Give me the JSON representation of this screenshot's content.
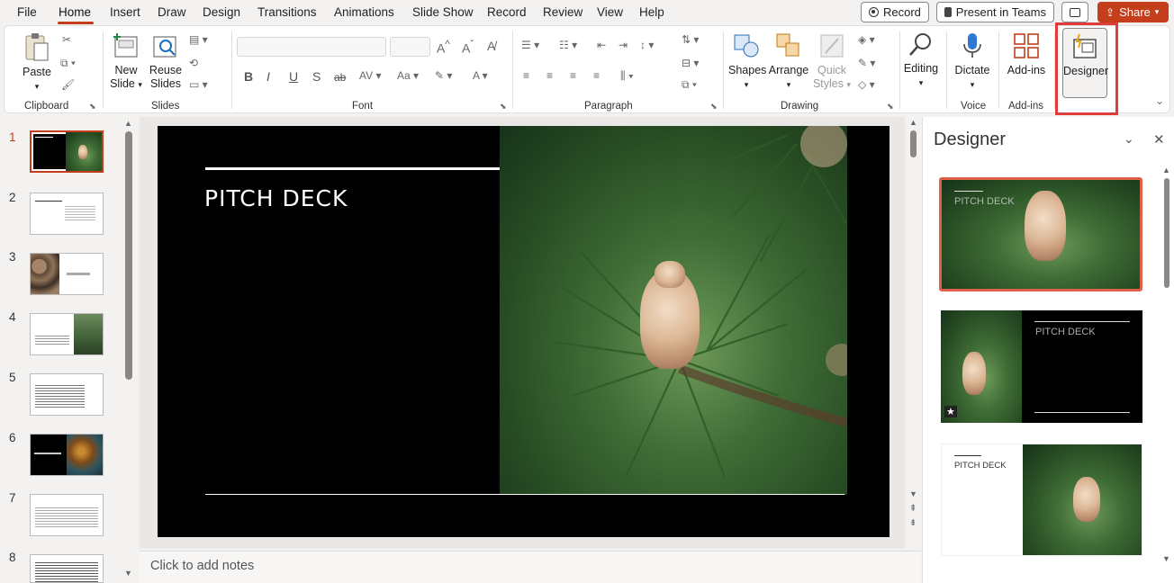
{
  "menu": {
    "tabs": [
      "File",
      "Home",
      "Insert",
      "Draw",
      "Design",
      "Transitions",
      "Animations",
      "Slide Show",
      "Record",
      "Review",
      "View",
      "Help"
    ],
    "active": "Home"
  },
  "titlebar": {
    "record_label": "Record",
    "present_label": "Present in Teams",
    "share_label": "Share"
  },
  "ribbon": {
    "clipboard": {
      "paste": "Paste",
      "group": "Clipboard"
    },
    "slides": {
      "new_slide_1": "New",
      "new_slide_2": "Slide",
      "reuse_1": "Reuse",
      "reuse_2": "Slides",
      "group": "Slides"
    },
    "font": {
      "group": "Font",
      "bold": "B",
      "italic": "I",
      "underline": "U",
      "shadow": "S",
      "strike": "ab"
    },
    "paragraph": {
      "group": "Paragraph"
    },
    "drawing": {
      "shapes": "Shapes",
      "arrange": "Arrange",
      "quick_1": "Quick",
      "quick_2": "Styles",
      "group": "Drawing"
    },
    "editing": {
      "label": "Editing"
    },
    "voice": {
      "dictate": "Dictate",
      "group": "Voice"
    },
    "addins": {
      "label": "Add-ins",
      "group": "Add-ins"
    },
    "designer": {
      "label": "Designer"
    }
  },
  "thumbnails": {
    "numbers": [
      "1",
      "2",
      "3",
      "4",
      "5",
      "6",
      "7",
      "8"
    ]
  },
  "slide": {
    "title": "PITCH DECK"
  },
  "notes": {
    "placeholder": "Click to add notes"
  },
  "designer": {
    "title": "Designer",
    "card1_title": "PITCH DECK",
    "card2_title": "PITCH DECK",
    "card3_title": "PITCH DECK"
  },
  "colors": {
    "accent": "#c43e1c",
    "slide_bg": "#000000"
  }
}
